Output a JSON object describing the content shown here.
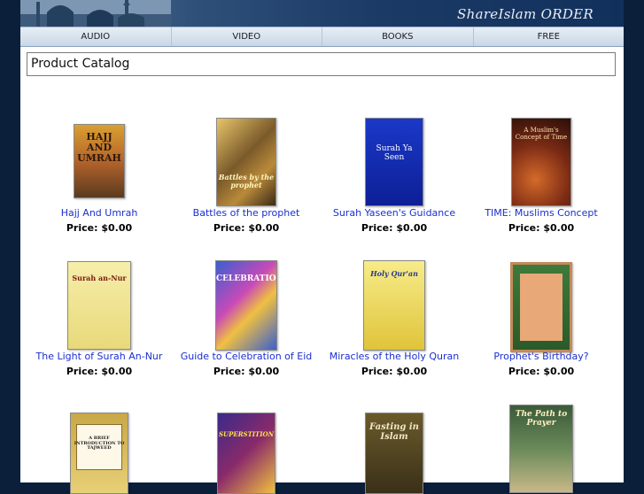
{
  "header": {
    "brand": "ShareIslam ORDER"
  },
  "nav": [
    {
      "label": "AUDIO"
    },
    {
      "label": "VIDEO"
    },
    {
      "label": "BOOKS"
    },
    {
      "label": "FREE"
    }
  ],
  "catalog": {
    "title": "Product Catalog"
  },
  "products": [
    {
      "name": "Hajj And Umrah",
      "price": "Price: $0.00",
      "cover_text": "HAJJ AND UMRAH"
    },
    {
      "name": "Battles of the prophet",
      "price": "Price: $0.00",
      "cover_text": "Battles by the prophet"
    },
    {
      "name": "Surah Yaseen's Guidance",
      "price": "Price: $0.00",
      "cover_text": "Surah Ya Seen"
    },
    {
      "name": "TIME: Muslims Concept",
      "price": "Price: $0.00",
      "cover_text": "A Muslim's Concept of Time"
    },
    {
      "name": "The Light of Surah An-Nur",
      "price": "Price: $0.00",
      "cover_text": "Surah an-Nur"
    },
    {
      "name": "Guide to Celebration of Eid",
      "price": "Price: $0.00",
      "cover_text": "CELEBRATION"
    },
    {
      "name": "Miracles of the Holy Quran",
      "price": "Price: $0.00",
      "cover_text": "Holy Qur'an"
    },
    {
      "name": "Prophet's Birthday?",
      "price": "Price: $0.00",
      "cover_text": ""
    },
    {
      "name": "",
      "price": "",
      "cover_text": "A BRIEF INTRODUCTION TO TAJWEED"
    },
    {
      "name": "",
      "price": "",
      "cover_text": "SUPERSTITION"
    },
    {
      "name": "",
      "price": "",
      "cover_text": "Fasting in Islam"
    },
    {
      "name": "",
      "price": "",
      "cover_text": "The Path to Prayer"
    }
  ]
}
